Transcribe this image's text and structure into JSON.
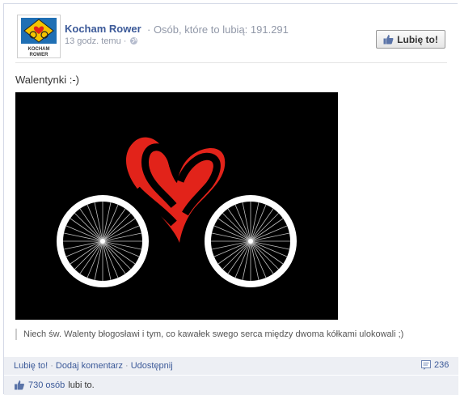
{
  "post": {
    "page_name": "Kocham Rower",
    "likes_label": "· Osób, które to lubią: 191.291",
    "time": "13 godz. temu ·",
    "like_page_button": "Lubię to!",
    "text": "Walentynki :-)",
    "avatar_text_line1": "KOCHAM",
    "avatar_text_line2": "ROWER",
    "caption": "Niech św. Walenty błogosławi i tym, co kawałek swego serca między dwoma kółkami ulokowali ;)"
  },
  "actions": {
    "like": "Lubię to!",
    "comment": "Dodaj komentarz",
    "share": "Udostępnij",
    "separator": "·",
    "comment_count": "236"
  },
  "likes": {
    "count_link": "730 osób",
    "suffix": "lubi to."
  },
  "colors": {
    "link": "#3b5998",
    "heart": "#e2231a",
    "photo_bg": "#000000"
  },
  "icons": [
    "globe-icon",
    "thumbs-up-icon",
    "comment-icon"
  ]
}
